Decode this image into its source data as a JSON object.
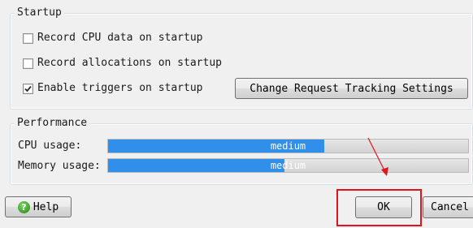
{
  "startup": {
    "title": "Startup",
    "record_cpu": {
      "label": "Record CPU data on startup",
      "checked": false
    },
    "record_alloc": {
      "label": "Record allocations on startup",
      "checked": false
    },
    "enable_triggers": {
      "label": "Enable triggers on startup",
      "checked": true
    },
    "change_tracking_label": "Change Request Tracking Settings"
  },
  "performance": {
    "title": "Performance",
    "cpu": {
      "label": "CPU usage:",
      "level_text": "medium",
      "level_fraction": 0.6
    },
    "memory": {
      "label": "Memory usage:",
      "level_text": "medium",
      "level_fraction": 0.49
    }
  },
  "footer": {
    "help_label": "Help",
    "ok_label": "OK",
    "cancel_label": "Cancel"
  },
  "colors": {
    "gauge_fill": "#2f8fea",
    "highlight": "#e0141b"
  }
}
